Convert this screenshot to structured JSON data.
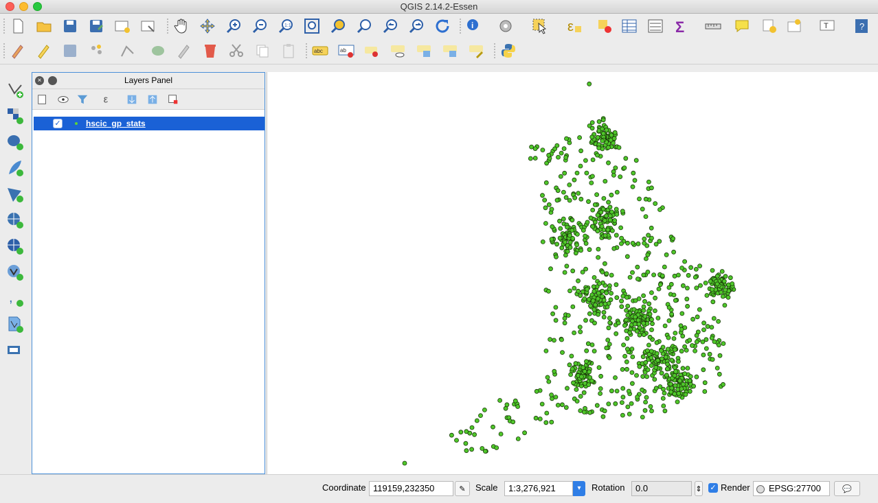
{
  "window": {
    "title": "QGIS 2.14.2-Essen"
  },
  "panel": {
    "title": "Layers Panel",
    "layers": [
      {
        "name": "hscic_gp_stats",
        "checked": true
      }
    ]
  },
  "status": {
    "coordinate_label": "Coordinate",
    "coordinate_value": "119159,232350",
    "scale_label": "Scale",
    "scale_value": "1:3,276,921",
    "rotation_label": "Rotation",
    "rotation_value": "0.0",
    "render_label": "Render",
    "crs": "EPSG:27700"
  },
  "colors": {
    "point_fill": "#4fc72a",
    "point_stroke": "#1a3a0a",
    "selection": "#1a61d6"
  }
}
